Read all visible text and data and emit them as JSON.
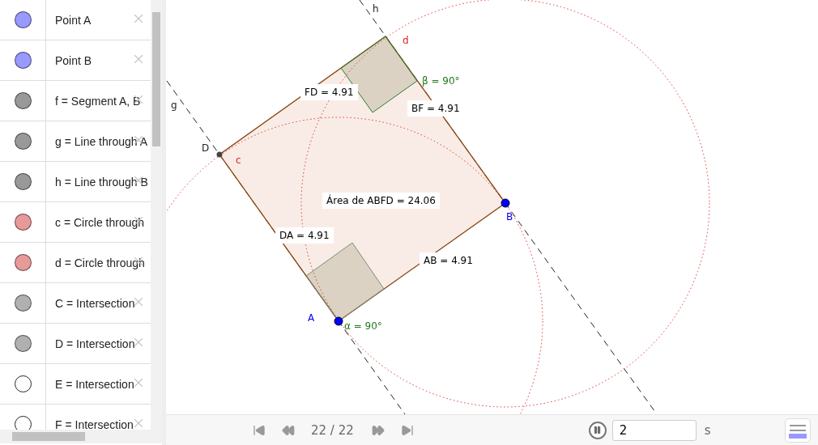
{
  "algebra": {
    "items": [
      {
        "label": "Point A",
        "color": "#9999ff",
        "visible": true
      },
      {
        "label": "Point B",
        "color": "#9999ff",
        "visible": true
      },
      {
        "label": "f = Segment A, B",
        "color": "#999999",
        "visible": true
      },
      {
        "label": "g = Line through A",
        "color": "#999999",
        "visible": true
      },
      {
        "label": "h = Line through B",
        "color": "#999999",
        "visible": true
      },
      {
        "label": "c = Circle through",
        "color": "#e89999",
        "visible": true
      },
      {
        "label": "d = Circle through",
        "color": "#e89999",
        "visible": true
      },
      {
        "label": "C = Intersection",
        "color": "#b0b0b0",
        "visible": true
      },
      {
        "label": "D = Intersection",
        "color": "#b0b0b0",
        "visible": true
      },
      {
        "label": "E = Intersection",
        "color": "#222222",
        "visible": false
      },
      {
        "label": "F = Intersection",
        "color": "#222222",
        "visible": false
      }
    ]
  },
  "canvas": {
    "labels": [
      {
        "kind": "line",
        "text": "h"
      },
      {
        "kind": "circle",
        "text": "d"
      },
      {
        "kind": "measure",
        "text": "FD = 4.91"
      },
      {
        "kind": "angle",
        "text": "β = 90°"
      },
      {
        "kind": "measure",
        "text": "BF = 4.91"
      },
      {
        "kind": "line",
        "text": "g"
      },
      {
        "kind": "point",
        "text": "D"
      },
      {
        "kind": "circle",
        "text": "c"
      },
      {
        "kind": "measure",
        "text": "Área de  ABFD = 24.06"
      },
      {
        "kind": "free-point",
        "text": "B"
      },
      {
        "kind": "measure",
        "text": "DA = 4.91"
      },
      {
        "kind": "measure",
        "text": "AB = 4.91"
      },
      {
        "kind": "free-point",
        "text": "A"
      },
      {
        "kind": "angle",
        "text": "α = 90°"
      }
    ]
  },
  "player": {
    "step": "22 / 22",
    "playing": true,
    "speed": "2",
    "unit": "s"
  }
}
